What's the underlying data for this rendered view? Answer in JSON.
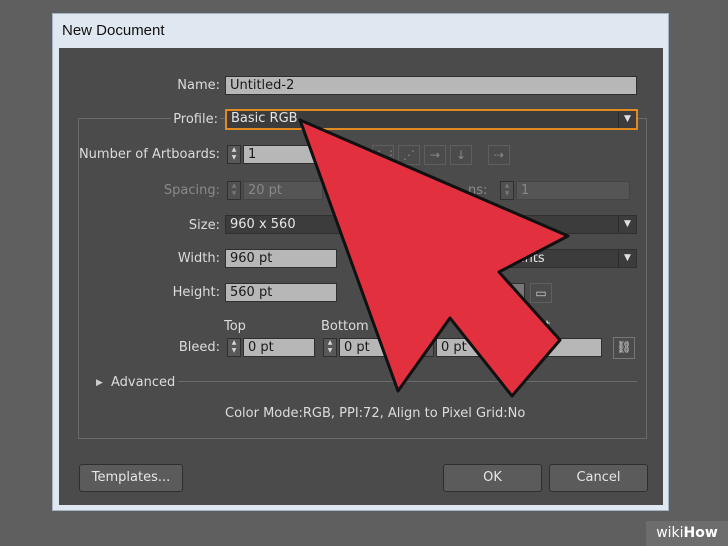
{
  "window": {
    "title": "New Document"
  },
  "form": {
    "name": {
      "label": "Name:",
      "value": "Untitled-2"
    },
    "profile": {
      "label": "Profile:",
      "value": "Basic RGB"
    },
    "artboards": {
      "label": "Number of Artboards:",
      "value": "1"
    },
    "spacing": {
      "label": "Spacing:",
      "value": "20 pt"
    },
    "columns": {
      "label": "ns:",
      "value": "1"
    },
    "size": {
      "label": "Size:",
      "value": "960 x 560"
    },
    "width": {
      "label": "Width:",
      "value": "960 pt"
    },
    "units": {
      "value": "oints"
    },
    "height": {
      "label": "Height:",
      "value": "560 pt"
    },
    "bleed": {
      "label": "Bleed:",
      "top": {
        "label": "Top",
        "value": "0 pt"
      },
      "bottom": {
        "label": "Bottom",
        "value": "0 pt"
      },
      "left": {
        "label": "ft",
        "value": "0 pt"
      },
      "right": {
        "label": "ht",
        "value": "pt"
      }
    },
    "advanced": {
      "label": "Advanced"
    },
    "info": "Color Mode:RGB, PPI:72, Align to Pixel Grid:No"
  },
  "buttons": {
    "templates": "Templates...",
    "ok": "OK",
    "cancel": "Cancel"
  },
  "watermark": {
    "brand_a": "wiki",
    "brand_b": "How"
  },
  "icons": [
    "dropdown-arrow-icon",
    "stepper-icon",
    "grid-by-row-icon",
    "grid-by-column-icon",
    "arrange-by-row-icon",
    "arrange-by-column-icon",
    "right-to-left-icon",
    "portrait-icon",
    "landscape-icon",
    "link-icon",
    "disclosure-triangle-icon",
    "pointer-arrow-annotation"
  ],
  "colors": {
    "accent_focus": "#e08a22",
    "annotation_arrow": "#e2303f"
  }
}
